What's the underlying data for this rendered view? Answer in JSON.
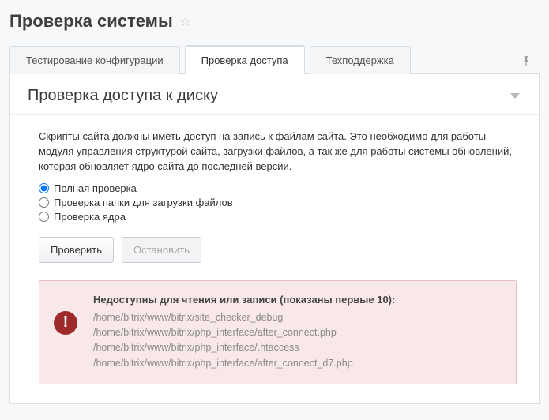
{
  "header": {
    "title": "Проверка системы"
  },
  "tabs": {
    "items": [
      {
        "label": "Тестирование конфигурации",
        "active": false
      },
      {
        "label": "Проверка доступа",
        "active": true
      },
      {
        "label": "Техподдержка",
        "active": false
      }
    ]
  },
  "panel": {
    "title": "Проверка доступа к диску",
    "description": "Скрипты сайта должны иметь доступ на запись к файлам сайта. Это необходимо для работы модуля управления структурой сайта, загрузки файлов, а так же для работы системы обновлений, которая обновляет ядро сайта до последней версии.",
    "options": [
      {
        "label": "Полная проверка",
        "checked": true
      },
      {
        "label": "Проверка папки для загрузки файлов",
        "checked": false
      },
      {
        "label": "Проверка ядра",
        "checked": false
      }
    ],
    "buttons": {
      "check": "Проверить",
      "stop": "Остановить"
    }
  },
  "alert": {
    "title": "Недоступны для чтения или записи (показаны первые 10):",
    "paths": [
      "/home/bitrix/www/bitrix/site_checker_debug",
      "/home/bitrix/www/bitrix/php_interface/after_connect.php",
      "/home/bitrix/www/bitrix/php_interface/.htaccess",
      "/home/bitrix/www/bitrix/php_interface/after_connect_d7.php"
    ]
  }
}
